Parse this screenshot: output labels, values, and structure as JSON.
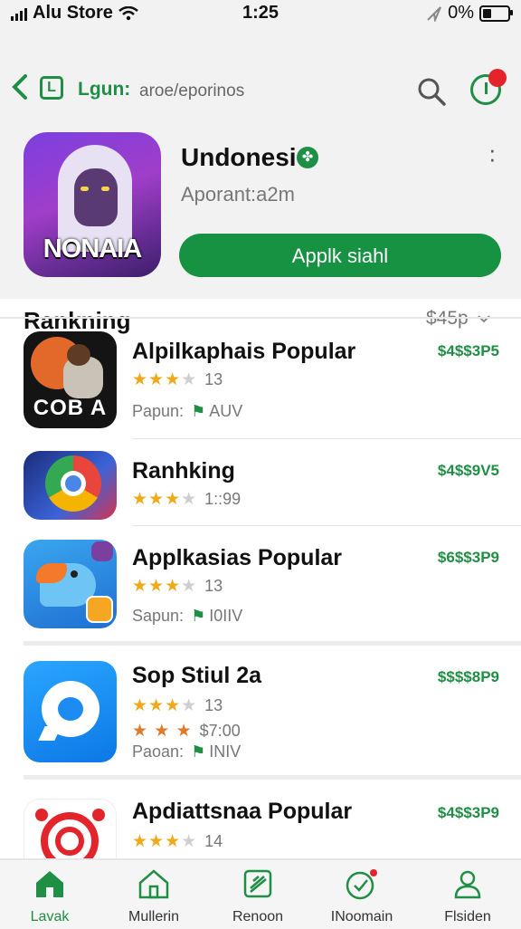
{
  "status_bar": {
    "carrier": "Alu Store",
    "time": "1:25",
    "battery": "0%"
  },
  "nav": {
    "title": "Lgun:",
    "subtitle": "aroe/eporinos"
  },
  "app": {
    "name": "Undonesi",
    "subtitle": "Aporant:a2m",
    "icon_text": "NONAIA",
    "install_label": "Applk siahl"
  },
  "ranking": {
    "title": "Rankning",
    "filter": "$45p"
  },
  "apps": [
    {
      "title": "Alpilkaphais Popular",
      "price": "$4$$3P5",
      "stars": 3,
      "count": "13",
      "meta_label": "Papun:",
      "meta_value": "AUV",
      "icon_text": "COB A"
    },
    {
      "title": "Ranhking",
      "price": "$4$$9V5",
      "stars": 3,
      "count": "1::99"
    },
    {
      "title": "Applkasias Popular",
      "price": "$6$$3P9",
      "stars": 3,
      "count": "13",
      "meta_label": "Sapun:",
      "meta_value": "I0IIV"
    },
    {
      "title": "Sop Stiul 2a",
      "price": "$$$$8P9",
      "stars": 3,
      "count": "13",
      "stars2_text": "$7:00",
      "meta_label": "Paoan:",
      "meta_value": "INIV"
    },
    {
      "title": "Apdiattsnaa Popular",
      "price": "$4$$3P9",
      "stars": 3,
      "count": "14"
    }
  ],
  "tabs": [
    {
      "label": "Lavak",
      "icon": "home-icon"
    },
    {
      "label": "Mullerin",
      "icon": "house-outline-icon"
    },
    {
      "label": "Renoon",
      "icon": "document-icon"
    },
    {
      "label": "INoomain",
      "icon": "heart-badge-icon"
    },
    {
      "label": "Flsiden",
      "icon": "person-icon"
    }
  ],
  "colors": {
    "accent": "#169242",
    "star": "#f0a91b",
    "badge": "#e3242b"
  }
}
